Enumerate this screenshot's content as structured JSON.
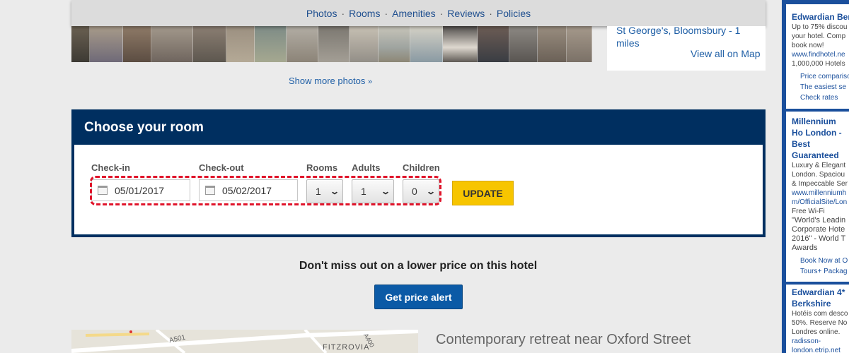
{
  "nav": {
    "items": [
      "Photos",
      "Rooms",
      "Amenities",
      "Reviews",
      "Policies"
    ],
    "separator": "·"
  },
  "location": {
    "text": "St George's, Bloomsbury - 1 miles",
    "map_link": "View all on Map"
  },
  "photos": {
    "show_more": "Show more photos",
    "show_more_icon": "double-chevron-down-icon"
  },
  "room_panel": {
    "title": "Choose your room",
    "checkin": {
      "label": "Check-in",
      "value": "05/01/2017",
      "icon": "calendar-icon"
    },
    "checkout": {
      "label": "Check-out",
      "value": "05/02/2017",
      "icon": "calendar-icon"
    },
    "rooms": {
      "label": "Rooms",
      "value": "1"
    },
    "adults": {
      "label": "Adults",
      "value": "1"
    },
    "children": {
      "label": "Children",
      "value": "0"
    },
    "update": "UPDATE"
  },
  "promo": {
    "text": "Don't miss out on a lower price on this hotel",
    "button": "Get price alert"
  },
  "map": {
    "labels": [
      "A501",
      "FITZROVIA",
      "A400"
    ]
  },
  "section_heading": "Contemporary retreat near Oxford Street",
  "ads": [
    {
      "title": "Edwardian Ber",
      "body": [
        "Up to 75% discou",
        "your hotel. Comp",
        "book now!"
      ],
      "url": "www.findhotel.ne",
      "extra": "1,000,000 Hotels",
      "sublinks": [
        "Price comparison",
        "The easiest se",
        "Check rates"
      ]
    },
    {
      "title": "Millennium Ho London - Best Guaranteed",
      "body": [
        "Luxury & Elegant",
        "London. Spaciou",
        "& Impeccable Ser"
      ],
      "url": "www.millenniumh m/OfficialSite/Lon",
      "extra": "Free Wi-Fi",
      "quote": "\"World's Leadin Corporate Hote 2016\" - World T Awards",
      "sublinks": [
        "Book Now at O",
        "Tours+ Packag"
      ]
    },
    {
      "title": "Edwardian 4* Berkshire",
      "body": [
        "Hotéis com desco",
        "50%. Reserve No",
        "Londres online."
      ],
      "url": "radisson-london.etrip.net"
    }
  ],
  "colors": {
    "panel": "#002f60",
    "link": "#1f5fa6",
    "update": "#f7c500",
    "alert_button": "#0b5aa6",
    "highlight": "#e0142a"
  }
}
